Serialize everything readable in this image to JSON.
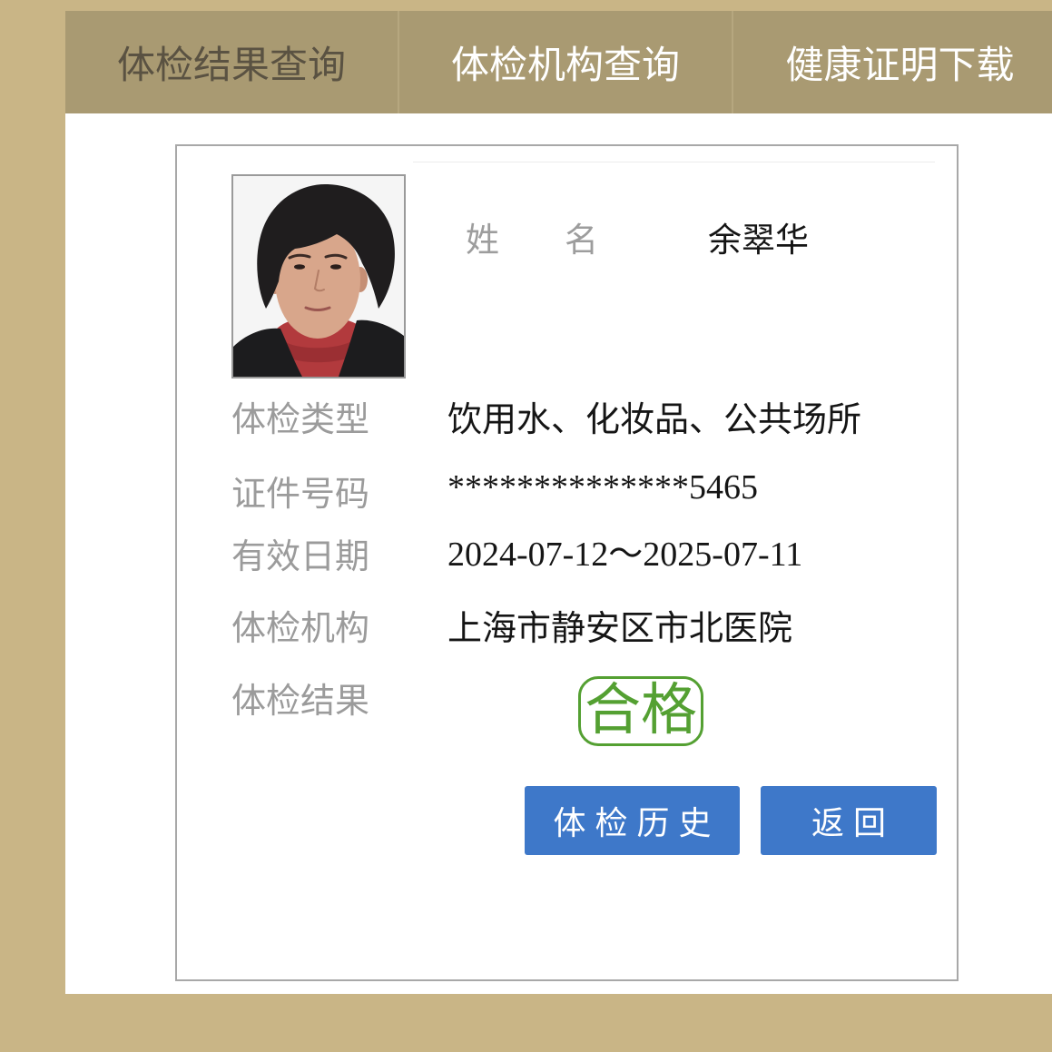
{
  "nav": {
    "tabs": [
      {
        "label": "体检结果查询",
        "active": true
      },
      {
        "label": "体检机构查询",
        "active": false
      },
      {
        "label": "健康证明下载",
        "active": false
      }
    ]
  },
  "card": {
    "name": {
      "label": "姓名",
      "value": "余翠华"
    },
    "fields": [
      {
        "label": "体检类型",
        "value": "饮用水、化妆品、公共场所"
      },
      {
        "label": "证件号码",
        "value": "**************5465"
      },
      {
        "label": "有效日期",
        "value": "2024-07-12～2025-07-11"
      },
      {
        "label": "体检机构",
        "value": "上海市静安区市北医院"
      },
      {
        "label": "体检结果",
        "value": "合格"
      }
    ],
    "buttons": {
      "history": "体检历史",
      "back": "返回"
    }
  },
  "colors": {
    "page_bg": "#c9b586",
    "nav_bg": "#a99a72",
    "nav_active_text": "#5a5242",
    "button_bg": "#3e78c9",
    "stamp": "#54a032"
  }
}
